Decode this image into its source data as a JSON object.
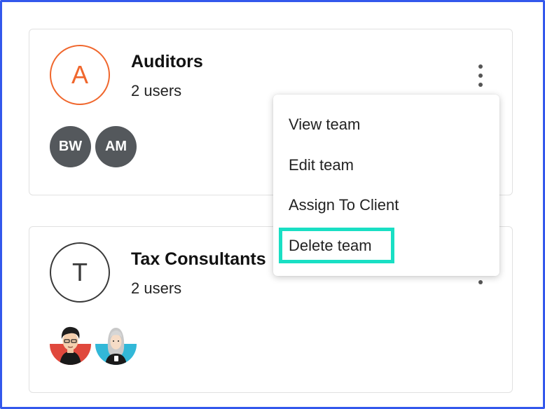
{
  "teams": [
    {
      "initial": "A",
      "name": "Auditors",
      "count": "2 users",
      "members": [
        "BW",
        "AM"
      ]
    },
    {
      "initial": "T",
      "name": "Tax Consultants",
      "count": "2 users",
      "members": [
        "photo-man",
        "photo-woman"
      ]
    }
  ],
  "menu": {
    "items": [
      "View team",
      "Edit team",
      "Assign To Client",
      "Delete team"
    ],
    "highlighted": "Delete team"
  },
  "colors": {
    "frame": "#3358ec",
    "auditors_accent": "#f0672d",
    "highlight": "#19dfc4",
    "member_avatar_bg": "#54585c"
  }
}
